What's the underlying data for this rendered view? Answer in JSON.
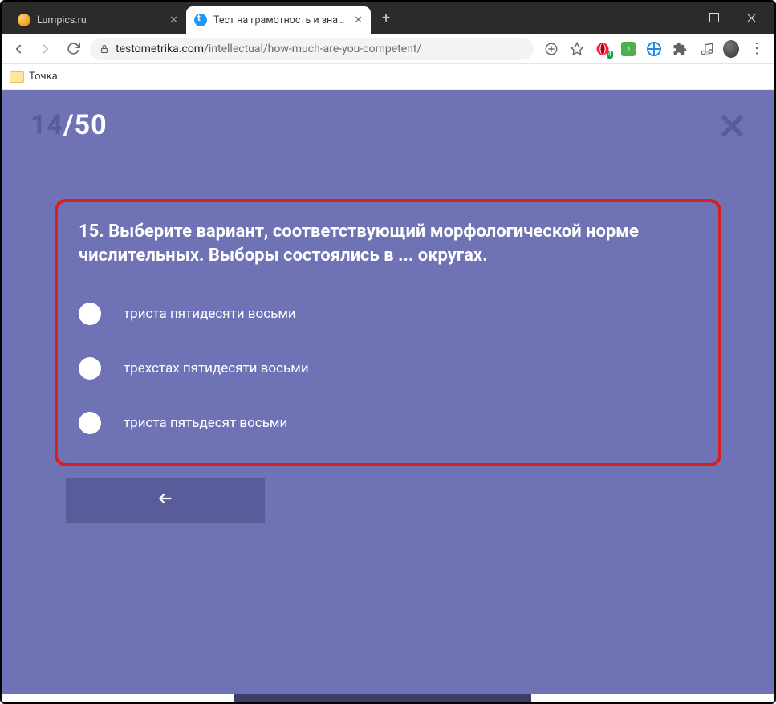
{
  "window": {
    "tabs": [
      {
        "title": "Lumpics.ru",
        "active": false
      },
      {
        "title": "Тест на грамотность и знание р",
        "active": true
      }
    ]
  },
  "address": {
    "host": "testometrika.com",
    "path": "/intellectual/how-much-are-you-competent/"
  },
  "bookmarks": {
    "item1": "Точка"
  },
  "extensions": {
    "opera_badge": "4"
  },
  "quiz": {
    "current": "14",
    "separator": "/",
    "total": "50",
    "question": "15. Выберите вариант, соответствующий морфологической норме числительных. Выборы состоялись в ... округах.",
    "answers": [
      "триста пятидесяти восьми",
      "трехстах пятидесяти восьми",
      "триста пятьдесят восьми"
    ]
  }
}
